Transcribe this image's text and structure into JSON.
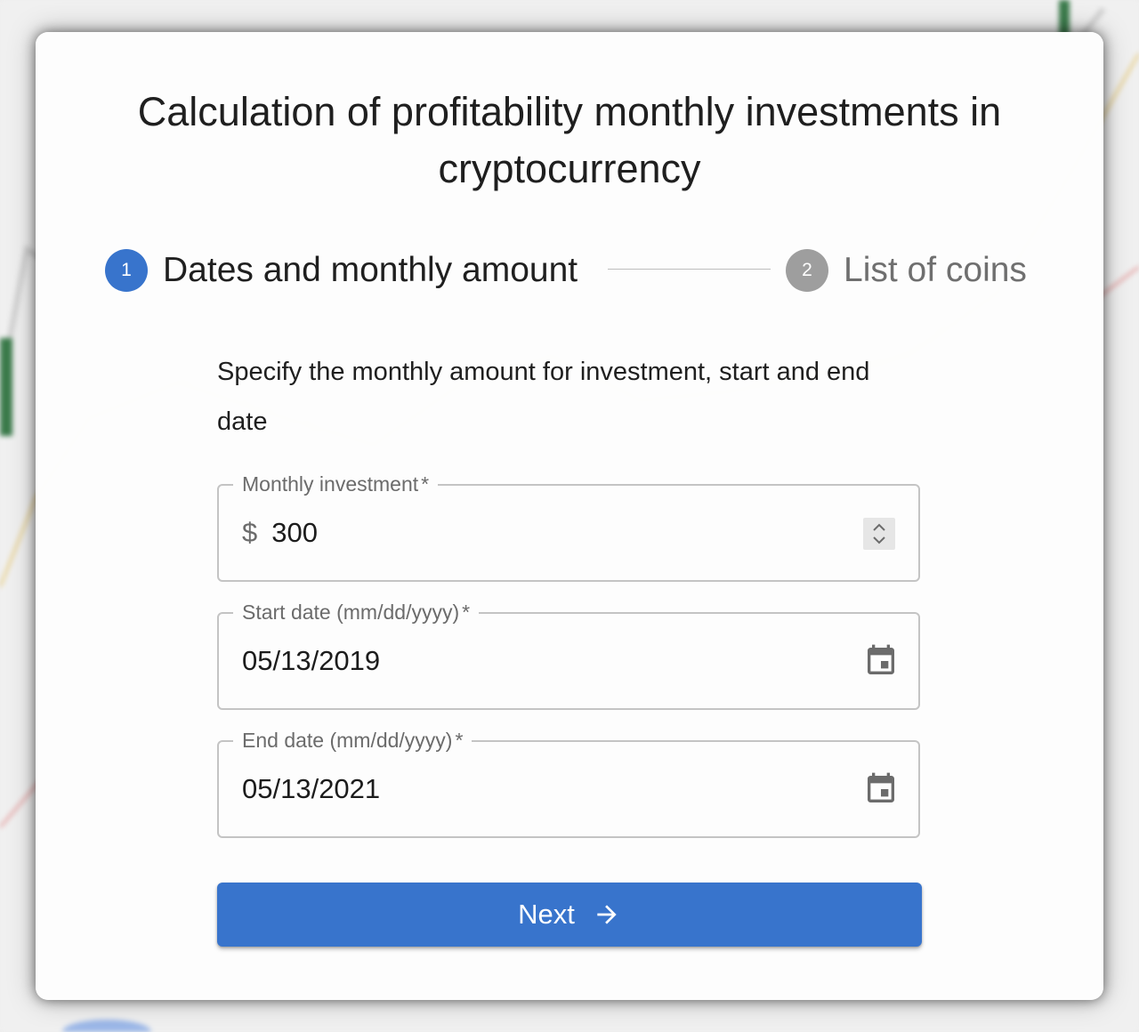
{
  "page": {
    "title": "Calculation of profitability monthly investments in cryptocurrency",
    "accent_color": "#3874cc"
  },
  "stepper": {
    "steps": [
      {
        "number": "1",
        "label": "Dates and monthly amount",
        "active": true
      },
      {
        "number": "2",
        "label": "List of coins",
        "active": false
      }
    ]
  },
  "form": {
    "description": "Specify the monthly amount for investment, start and end date",
    "monthly_investment": {
      "label": "Monthly investment",
      "required_mark": "*",
      "currency": "$",
      "value": "300",
      "icon": "spinner-arrows-icon"
    },
    "start_date": {
      "label": "Start date (mm/dd/yyyy)",
      "required_mark": "*",
      "value": "05/13/2019",
      "icon": "calendar-icon"
    },
    "end_date": {
      "label": "End date (mm/dd/yyyy)",
      "required_mark": "*",
      "value": "05/13/2021",
      "icon": "calendar-icon"
    },
    "next_button": {
      "label": "Next",
      "icon": "arrow-right-icon"
    }
  }
}
